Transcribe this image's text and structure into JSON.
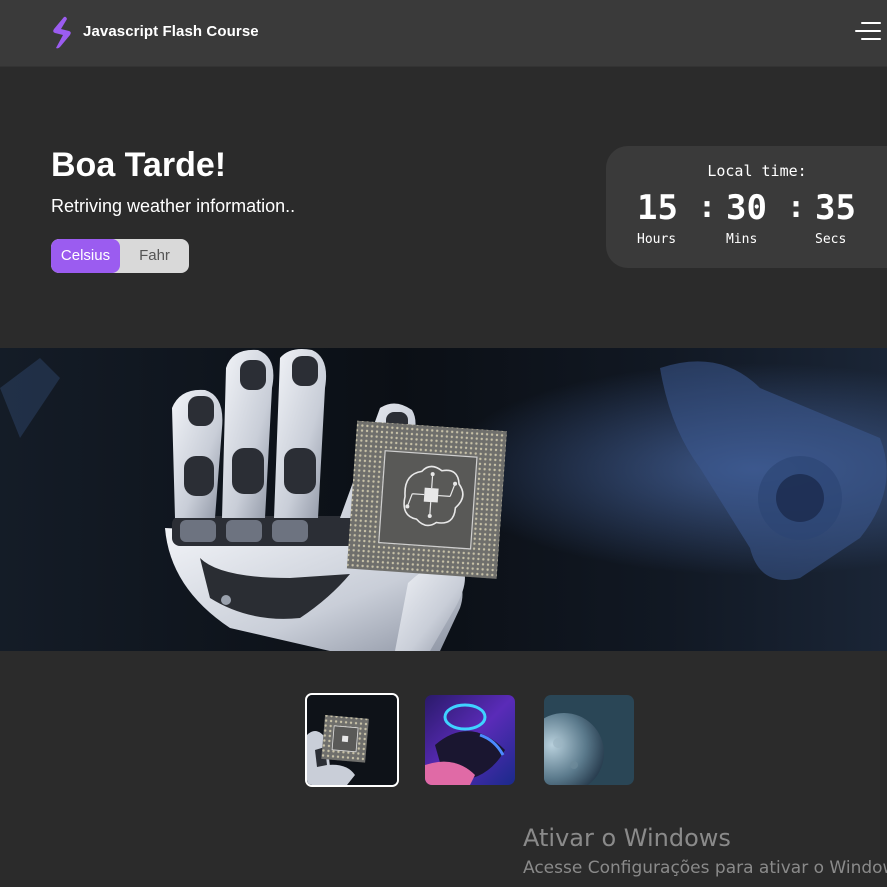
{
  "header": {
    "brand": "Javascript Flash Course",
    "logo_icon": "lightning-icon",
    "menu_icon": "hamburger-menu-icon"
  },
  "main": {
    "greeting": "Boa Tarde!",
    "weather_status": "Retriving weather information..",
    "units": {
      "celsius": "Celsius",
      "fahrenheit": "Fahr",
      "selected": "Celsius"
    }
  },
  "clock": {
    "label": "Local time:",
    "hours": "15",
    "minutes": "30",
    "seconds": "35",
    "separator": ":",
    "hours_label": "Hours",
    "minutes_label": "Mins",
    "seconds_label": "Secs"
  },
  "gallery": {
    "hero_image": "robot-hand-holding-chip",
    "thumbnails": [
      {
        "name": "robot-hand-chip",
        "active": true
      },
      {
        "name": "neon-gaming-mouse",
        "active": false
      },
      {
        "name": "planet",
        "active": false
      }
    ]
  },
  "overlay": {
    "activate_title": "Ativar o Windows",
    "activate_subtitle": "Acesse Configurações para ativar o Windows."
  },
  "colors": {
    "accent": "#9b5cf0",
    "background": "#2b2b2b",
    "topbar": "#3a3a3a"
  }
}
